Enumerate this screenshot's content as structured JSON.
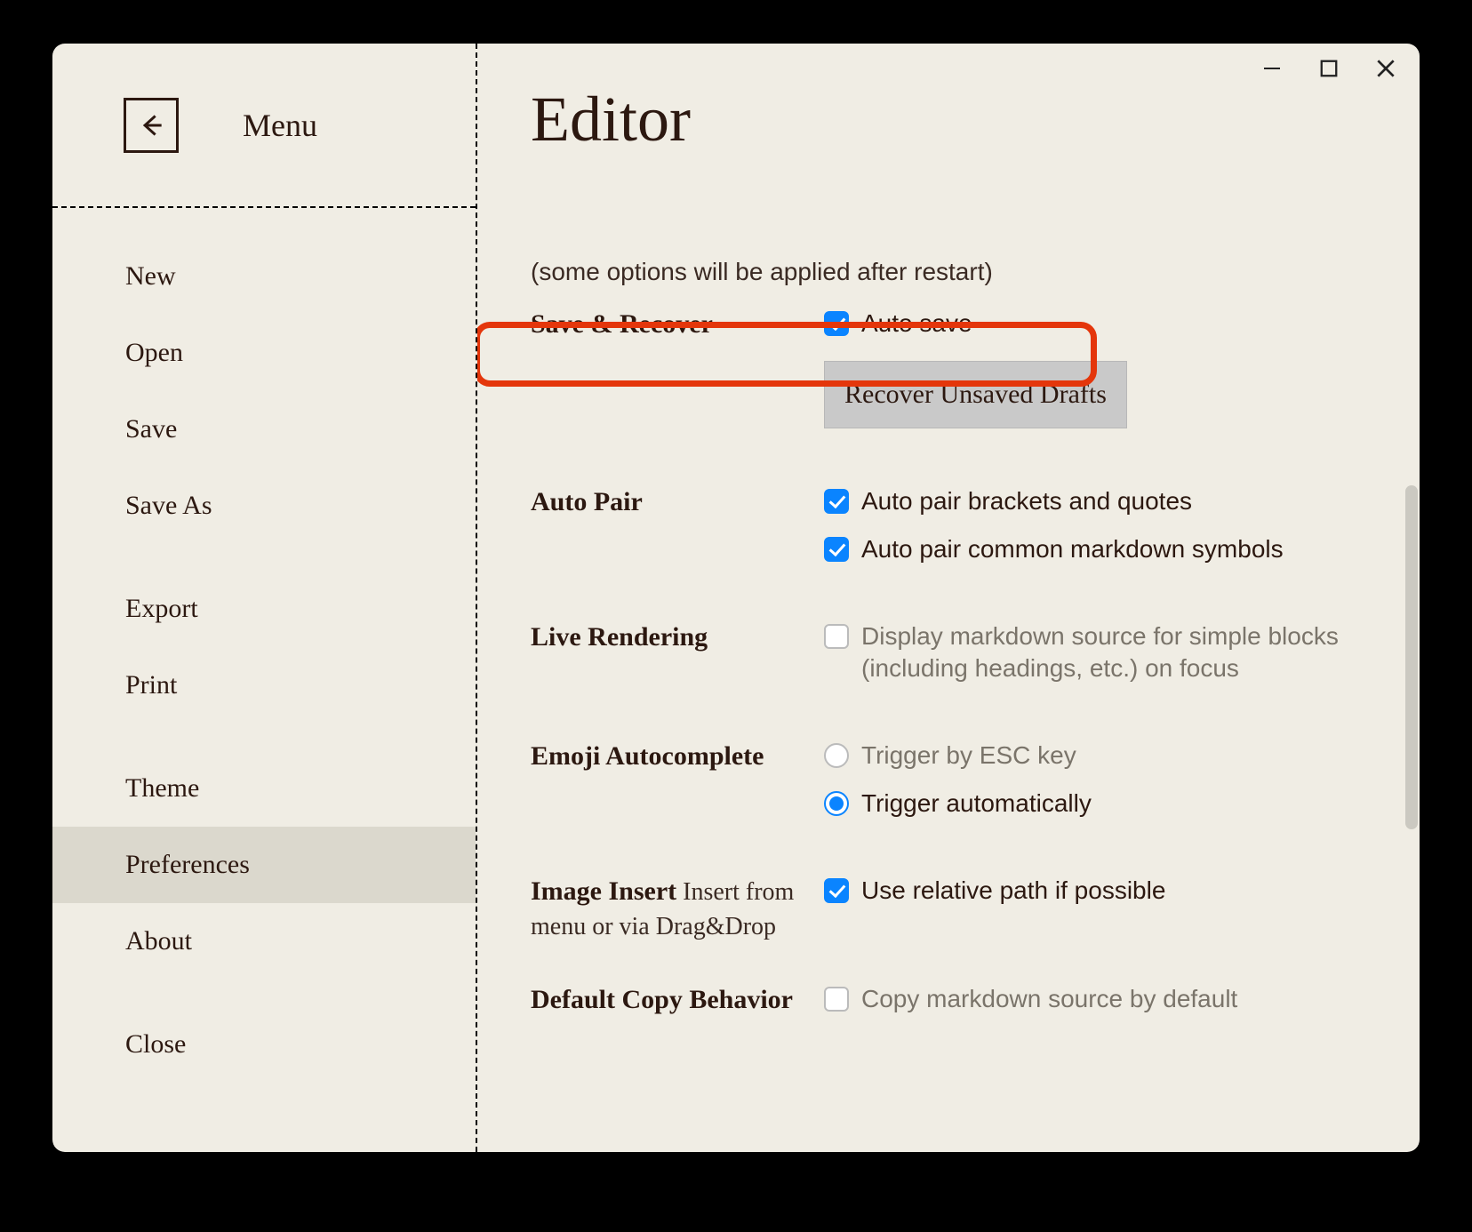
{
  "titlebar": {
    "minimize": "minimize",
    "maximize": "maximize",
    "close": "close"
  },
  "sidebar": {
    "menu_title": "Menu",
    "items": [
      {
        "label": "New"
      },
      {
        "label": "Open"
      },
      {
        "label": "Save"
      },
      {
        "label": "Save As"
      },
      {
        "label": "Export"
      },
      {
        "label": "Print"
      },
      {
        "label": "Theme"
      },
      {
        "label": "Preferences"
      },
      {
        "label": "About"
      },
      {
        "label": "Close"
      }
    ]
  },
  "page": {
    "title": "Editor",
    "hint": "(some options will be applied after restart)"
  },
  "sections": {
    "save_recover": {
      "label": "Save & Recover",
      "auto_save_label": "Auto save",
      "recover_button": "Recover Unsaved Drafts"
    },
    "auto_pair": {
      "label": "Auto Pair",
      "opt1": "Auto pair brackets and quotes",
      "opt2": "Auto pair common markdown symbols"
    },
    "live_rendering": {
      "label": "Live Rendering",
      "opt1": "Display markdown source for simple blocks (including headings, etc.) on focus"
    },
    "emoji": {
      "label": "Emoji Autocomplete",
      "opt1": "Trigger by ESC key",
      "opt2": "Trigger automatically"
    },
    "image_insert": {
      "label_bold": "Image Insert",
      "label_rest": " Insert from menu or via Drag&Drop",
      "opt1": "Use relative path if possible"
    },
    "default_copy": {
      "label": "Default Copy Behavior",
      "opt1": "Copy markdown source by default"
    }
  }
}
